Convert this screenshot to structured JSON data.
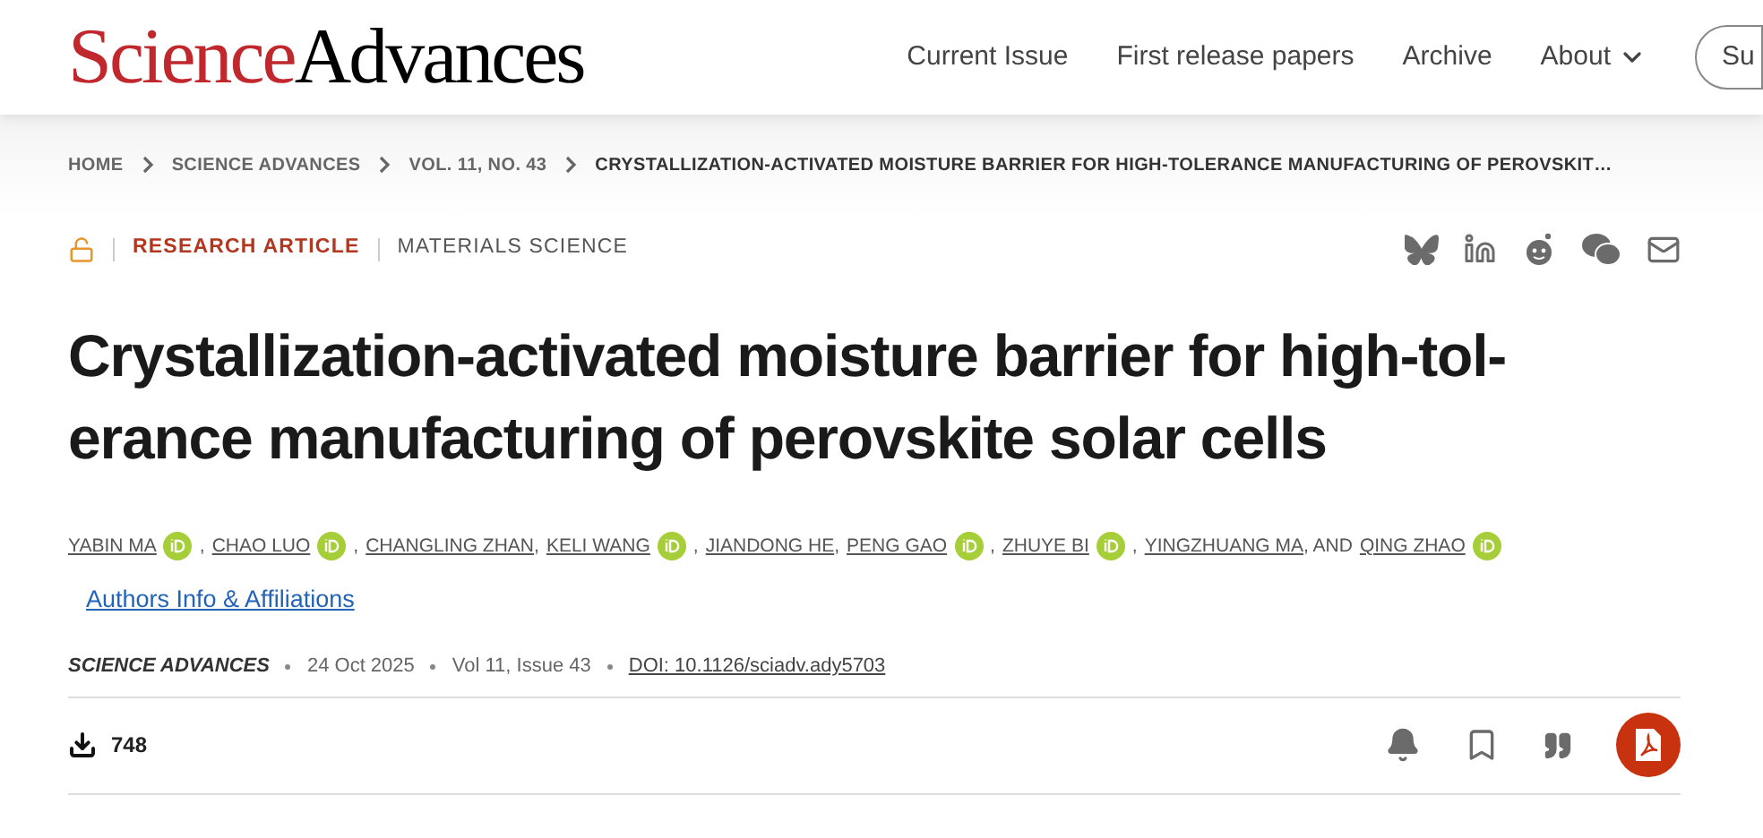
{
  "header": {
    "logo": {
      "part_1": "Science",
      "part_2": "Advances"
    },
    "nav": [
      {
        "label": "Current Issue",
        "kind": "link"
      },
      {
        "label": "First release papers",
        "kind": "link"
      },
      {
        "label": "Archive",
        "kind": "link"
      },
      {
        "label": "About",
        "kind": "menu"
      }
    ],
    "button": "Su"
  },
  "breadcrumb": [
    "HOME",
    "SCIENCE ADVANCES",
    "VOL. 11, NO. 43",
    "CRYSTALLIZATION-ACTIVATED MOISTURE BARRIER FOR HIGH-TOLERANCE MANUFACTURING OF PEROVSKIT…"
  ],
  "article": {
    "open_access": true,
    "type": "RESEARCH ARTICLE",
    "subject": "MATERIALS SCIENCE",
    "title": "Crystallization-activated moisture barrier for high-tol-erance manufacturing of perovskite solar cells",
    "authors": [
      {
        "name": "YABIN MA",
        "orcid": true,
        "separator": ","
      },
      {
        "name": "CHAO LUO",
        "orcid": true,
        "separator": ","
      },
      {
        "name": "CHANGLING ZHAN",
        "orcid": false,
        "separator": ","
      },
      {
        "name": "KELI WANG",
        "orcid": true,
        "separator": ","
      },
      {
        "name": "JIANDONG HE",
        "orcid": false,
        "separator": ","
      },
      {
        "name": "PENG GAO",
        "orcid": true,
        "separator": ","
      },
      {
        "name": "ZHUYE BI",
        "orcid": true,
        "separator": ","
      },
      {
        "name": "YINGZHUANG MA",
        "orcid": false,
        "separator": ", AND"
      },
      {
        "name": "QING ZHAO",
        "orcid": true
      }
    ],
    "authors_link": "Authors Info & Affiliations",
    "journal": "SCIENCE ADVANCES",
    "date": "24 Oct 2025",
    "volume": "Vol 11, Issue 43",
    "doi": "DOI: 10.1126/sciadv.ady5703",
    "downloads": "748"
  }
}
